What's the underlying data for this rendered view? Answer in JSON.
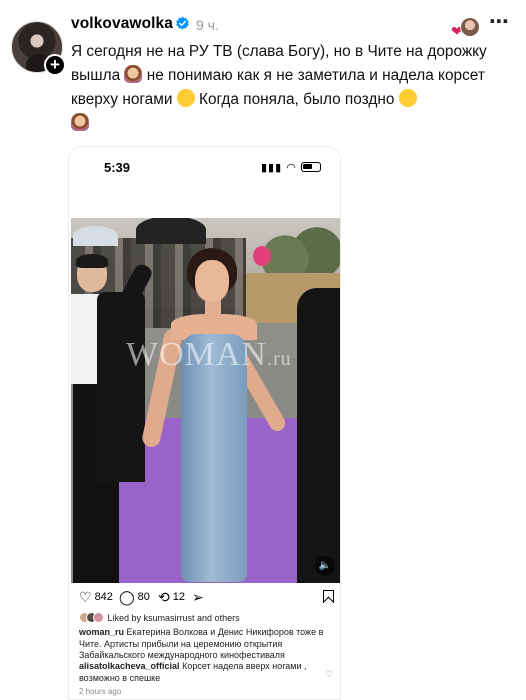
{
  "post": {
    "username": "volkovawolka",
    "time": "9 ч.",
    "more_icon": "⋯",
    "caption": {
      "part1": "Я сегодня не на РУ ТВ (слава Богу), но в Чите на дорожку вышла",
      "part2": "не понимаю как я не заметила и надела корсет кверху ногами",
      "part3": "Когда поняла, было поздно"
    }
  },
  "screenshot": {
    "status_time": "5:39",
    "watermark": "WOMAN",
    "watermark_suffix": ".ru",
    "actions": {
      "likes": "842",
      "comments": "80",
      "reposts": "12"
    },
    "liked_by": "Liked by ksumasirrust and others",
    "post_author": "woman_ru",
    "post_text": "Екатерина Волкова и Денис Никифоров тоже в Чите. Артисты прибыли на церемонию открытия Забайкальского международного кинофестиваля",
    "comment_author": "alisatolkacheva_official",
    "comment_text": "Корсет надела вверх ногами , возможно в спешке",
    "timestamp": "2 hours ago"
  },
  "colors": {
    "verified": "#0095f6",
    "carpet": "#9a63c8",
    "heart": "#e0245e"
  }
}
